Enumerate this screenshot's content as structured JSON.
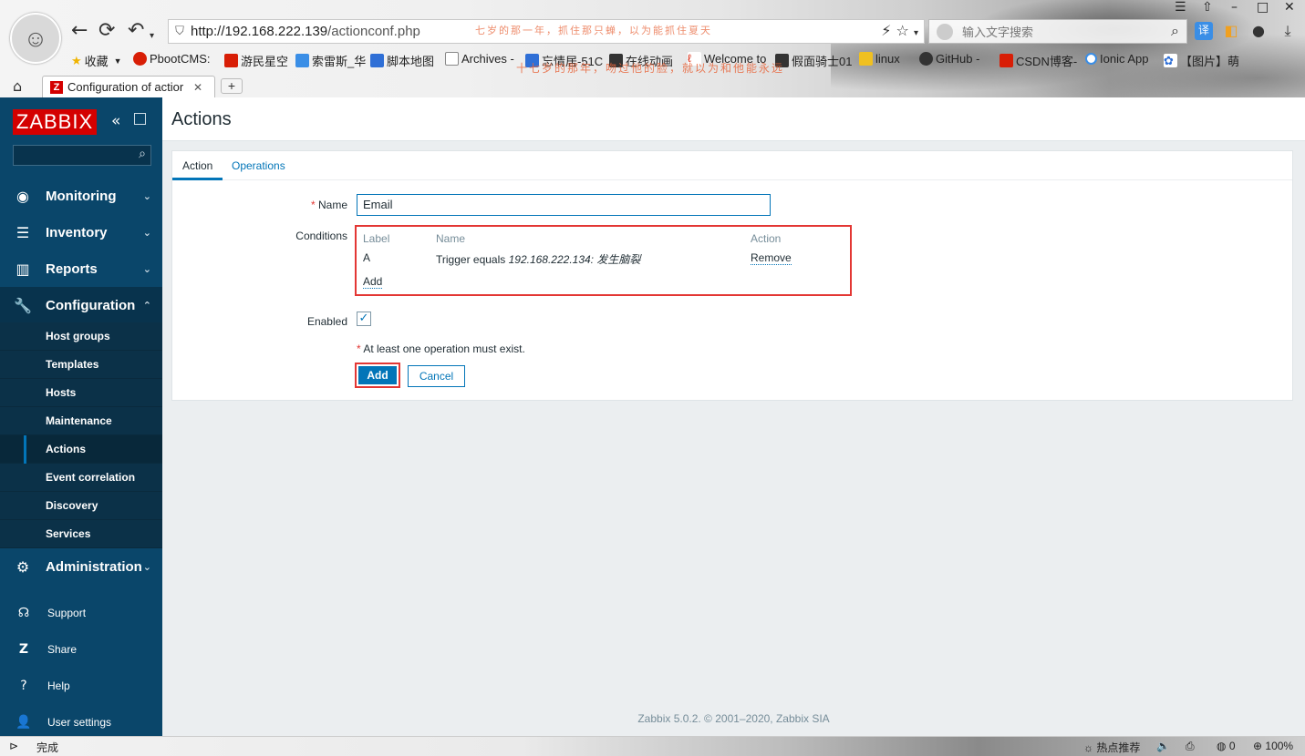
{
  "browser": {
    "url_host": "http://192.168.222.139",
    "url_path": "/actionconf.php",
    "url_marquee": "七岁的那一年，抓住那只蝉，以为能抓住夏天",
    "search_placeholder": "输入文字搜索",
    "bookmark_marquee": "十七岁的那年，吻过他的脸，就以为和他能永远",
    "bookmarks": [
      "收藏",
      "PbootCMS:",
      "游民星空",
      "索雷斯_华",
      "脚本地图",
      "Archives -",
      "忘情居-51C",
      "在线动画",
      "Welcome to",
      "假面骑士01",
      "linux",
      "GitHub -",
      "CSDN博客-",
      "Ionic App",
      "【图片】萌"
    ],
    "tab_title": "Configuration of actior",
    "tab_icon_letter": "Z"
  },
  "sidebar": {
    "logo": "ZABBIX",
    "menu": [
      {
        "label": "Monitoring",
        "icon": "eye-icon"
      },
      {
        "label": "Inventory",
        "icon": "list-icon"
      },
      {
        "label": "Reports",
        "icon": "bar-chart-icon"
      },
      {
        "label": "Configuration",
        "icon": "wrench-icon"
      },
      {
        "label": "Administration",
        "icon": "gear-icon"
      }
    ],
    "config_submenu": [
      "Host groups",
      "Templates",
      "Hosts",
      "Maintenance",
      "Actions",
      "Event correlation",
      "Discovery",
      "Services"
    ],
    "bottom": [
      "Support",
      "Share",
      "Help",
      "User settings"
    ]
  },
  "page": {
    "title": "Actions",
    "tabs": [
      "Action",
      "Operations"
    ],
    "name_label": "Name",
    "name_value": "Email",
    "conditions_label": "Conditions",
    "conditions": {
      "headers": [
        "Label",
        "Name",
        "Action"
      ],
      "rows": [
        {
          "label": "A",
          "name_prefix": "Trigger equals ",
          "name_value": "192.168.222.134: 发生脑裂",
          "action": "Remove"
        }
      ],
      "add_link": "Add"
    },
    "enabled_label": "Enabled",
    "enabled": true,
    "note": "At least one operation must exist.",
    "add_button": "Add",
    "cancel_button": "Cancel",
    "footer": "Zabbix 5.0.2. © 2001–2020, Zabbix SIA"
  },
  "statusbar": {
    "status": "完成",
    "hot": "热点推荐",
    "zero": "0",
    "zoom": "100%"
  }
}
